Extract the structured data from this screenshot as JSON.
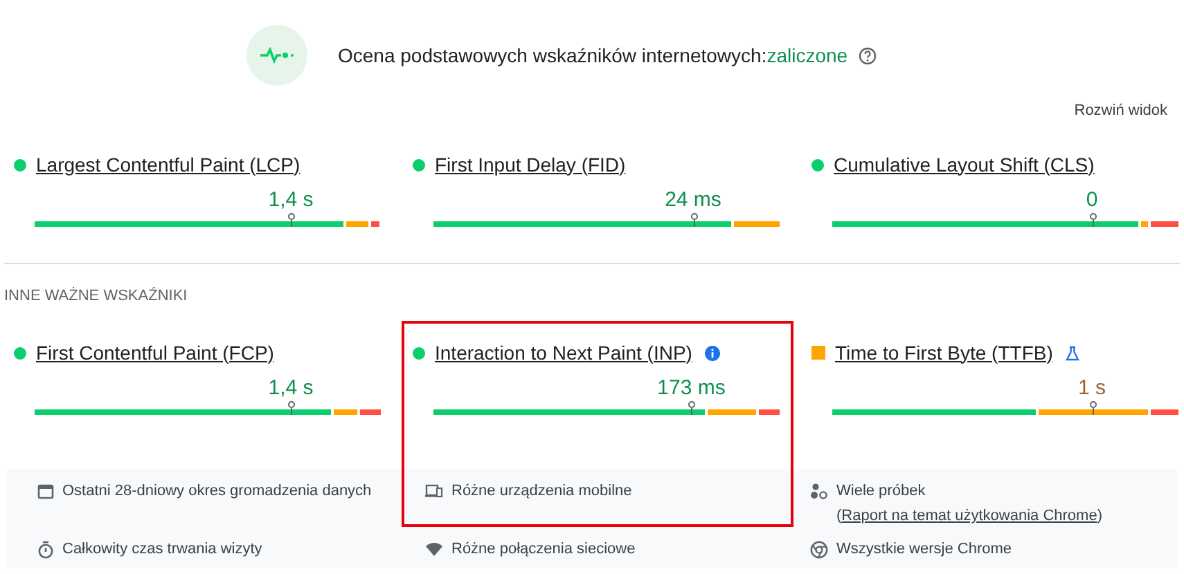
{
  "header": {
    "title": "Ocena podstawowych wskaźników internetowych:",
    "verdict": "zaliczone",
    "expand": "Rozwiń widok"
  },
  "core_metrics": [
    {
      "name": "Largest Contentful Paint (LCP)",
      "kind": "good",
      "value": "1,4 s",
      "segments": [
        {
          "kind": "good"
        },
        {
          "kind": "needs"
        },
        {
          "kind": "poor"
        }
      ]
    },
    {
      "name": "First Input Delay (FID)",
      "kind": "good",
      "value": "24 ms",
      "segments": [
        {
          "kind": "good"
        },
        {
          "kind": "needs"
        }
      ]
    },
    {
      "name": "Cumulative Layout Shift (CLS)",
      "kind": "good",
      "value": "0",
      "segments": [
        {
          "kind": "good"
        },
        {
          "kind": "needs"
        },
        {
          "kind": "poor"
        }
      ]
    }
  ],
  "other_section": {
    "label": "INNE WAŻNE WSKAŹNIKI"
  },
  "other_metrics": [
    {
      "name": "First Contentful Paint (FCP)",
      "kind": "good",
      "value": "1,4 s",
      "highlighted": false,
      "info_icon": false,
      "lab_icon": false,
      "segments": [
        {
          "kind": "good"
        },
        {
          "kind": "needs"
        },
        {
          "kind": "poor"
        }
      ]
    },
    {
      "name": "Interaction to Next Paint (INP)",
      "kind": "good",
      "value": "173 ms",
      "highlighted": true,
      "info_icon": true,
      "lab_icon": false,
      "segments": [
        {
          "kind": "good"
        },
        {
          "kind": "needs"
        },
        {
          "kind": "poor"
        }
      ]
    },
    {
      "name": "Time to First Byte (TTFB)",
      "kind": "needs",
      "value": "1 s",
      "highlighted": false,
      "info_icon": false,
      "lab_icon": true,
      "segments": [
        {
          "kind": "good"
        },
        {
          "kind": "needs"
        },
        {
          "kind": "poor"
        }
      ]
    }
  ],
  "footer": [
    {
      "text": "Ostatni 28-dniowy okres gromadzenia danych"
    },
    {
      "text": "Różne urządzenia mobilne"
    },
    {
      "text": "Wiele próbek (",
      "link": "Raport na temat użytkowania Chrome",
      "after": ")"
    },
    {
      "text": "Całkowity czas trwania wizyty"
    },
    {
      "text": "Różne połączenia sieciowe"
    },
    {
      "text": "Wszystkie wersje Chrome"
    }
  ]
}
